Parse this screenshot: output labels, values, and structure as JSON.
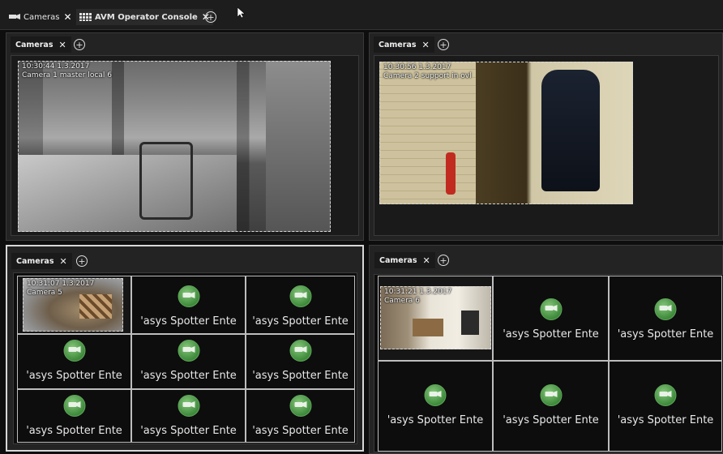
{
  "top_tabs": [
    {
      "label": "Cameras",
      "icon": "camera-icon"
    },
    {
      "label": "AVM Operator Console",
      "icon": "grid-icon"
    }
  ],
  "close_glyph": "✕",
  "add_glyph": "+",
  "panes": [
    {
      "tab": "Cameras",
      "overlay_time": "10:30:44  1.3.2017",
      "overlay_camera": "Camera 1 master local 6"
    },
    {
      "tab": "Cameras",
      "overlay_time": "10:30:56  1.3.2017",
      "overlay_camera": "Camera 2 support in ovl"
    },
    {
      "tab": "Cameras",
      "overlay_time": "10:31:07  1.3.2017",
      "overlay_camera": "Camera 5"
    },
    {
      "tab": "Cameras",
      "overlay_time": "10:31:21  1.3.2017",
      "overlay_camera": "Camera 6"
    }
  ],
  "placeholder_text": "'asys Spotter Ente",
  "colors": {
    "accent_green": "#4e9a4a",
    "background": "#0e0e0e",
    "pane": "#232323"
  }
}
